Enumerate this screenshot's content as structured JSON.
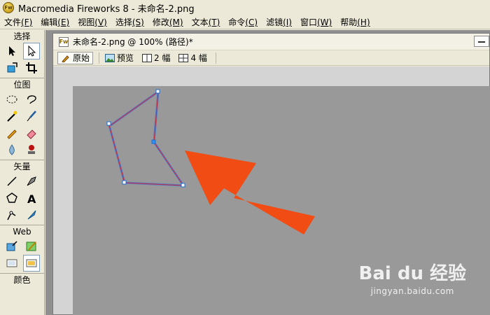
{
  "window": {
    "app_icon": "fireworks-logo-icon",
    "title": "Macromedia Fireworks 8 - 未命名-2.png"
  },
  "menubar": [
    {
      "label": "文件",
      "acc": "(F)"
    },
    {
      "label": "编辑",
      "acc": "(E)"
    },
    {
      "label": "视图",
      "acc": "(V)"
    },
    {
      "label": "选择",
      "acc": "(S)"
    },
    {
      "label": "修改",
      "acc": "(M)"
    },
    {
      "label": "文本",
      "acc": "(T)"
    },
    {
      "label": "命令",
      "acc": "(C)"
    },
    {
      "label": "滤镜",
      "acc": "(I)"
    },
    {
      "label": "窗口",
      "acc": "(W)"
    },
    {
      "label": "帮助",
      "acc": "(H)"
    }
  ],
  "tools": {
    "select": {
      "title": "选择",
      "items": [
        "pointer-icon",
        "subselect-icon",
        "scale-icon",
        "crop-icon"
      ]
    },
    "bitmap": {
      "title": "位图",
      "items": [
        "marquee-icon",
        "lasso-icon",
        "magic-wand-icon",
        "brush-icon",
        "pencil-icon",
        "eraser-icon",
        "blur-icon",
        "rubber-stamp-icon"
      ]
    },
    "vector": {
      "title": "矢量",
      "items": [
        "line-icon",
        "pen-icon",
        "rectangle-icon",
        "text-icon",
        "freeform-icon",
        "knife-icon"
      ]
    },
    "web": {
      "title": "Web",
      "items": [
        "hotspot-icon",
        "slice-icon",
        "hide-slices-icon",
        "show-slices-icon"
      ]
    },
    "colors": {
      "title": "颜色"
    }
  },
  "document": {
    "title": "未命名-2.png @ 100% (路径)*",
    "views": [
      {
        "label": "原始",
        "icon": "pencil-icon",
        "active": true
      },
      {
        "label": "预览",
        "icon": "image-preview-icon",
        "active": false
      },
      {
        "label": "2 幅",
        "icon": "two-up-icon",
        "active": false
      },
      {
        "label": "4 幅",
        "icon": "four-up-icon",
        "active": false
      }
    ]
  },
  "canvas": {
    "background": "#999999",
    "path_color": "#c0304a",
    "arrow_color": "#f04c14"
  },
  "watermark": {
    "logo": "Bai du 经验",
    "url": "jingyan.baidu.com"
  }
}
